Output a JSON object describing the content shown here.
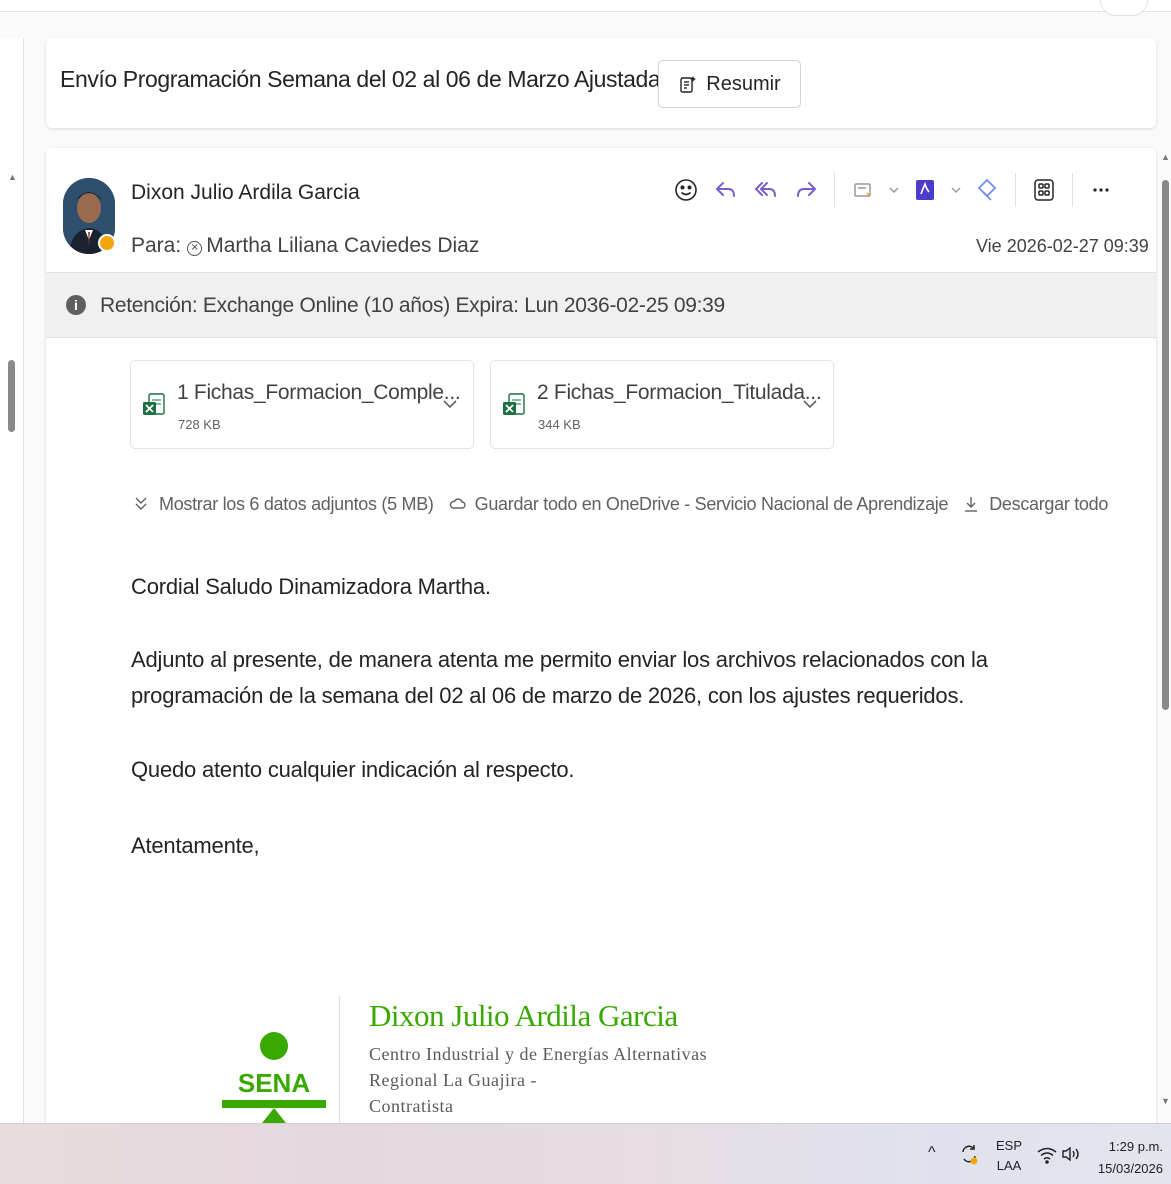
{
  "email": {
    "subject": "Envío Programación Semana del 02 al 06 de Marzo Ajustada.",
    "summarize_label": "Resumir",
    "sender": "Dixon Julio Ardila Garcia",
    "to_label": "Para:",
    "recipient": "Martha Liliana Caviedes Diaz",
    "date": "Vie 2026-02-27 09:39",
    "retention": "Retención: Exchange Online (10 años) Expira: Lun 2036-02-25 09:39",
    "actions": [
      "smiley-icon",
      "reply-icon",
      "reply-all-icon",
      "forward-icon",
      "note-icon",
      "pdf-icon",
      "loop-icon",
      "apps-icon",
      "more-icon"
    ]
  },
  "attachments": {
    "items": [
      {
        "name": "1 Fichas_Formacion_Comple...",
        "size": "728 KB",
        "icon": "excel-icon"
      },
      {
        "name": "2 Fichas_Formacion_Titulada...",
        "size": "344 KB",
        "icon": "excel-icon"
      }
    ],
    "show_all": "Mostrar los 6 datos adjuntos (5 MB)",
    "save_onedrive": "Guardar todo en OneDrive - Servicio Nacional de Aprendizaje",
    "download_all": "Descargar todo"
  },
  "body": {
    "greeting": "Cordial Saludo Dinamizadora Martha.",
    "paragraph1": "Adjunto al presente, de manera atenta me permito enviar los archivos relacionados con la programación de la semana del 02 al 06 de marzo de 2026, con los ajustes requeridos.",
    "paragraph2": "Quedo atento cualquier indicación al respecto.",
    "closing": "Atentamente,"
  },
  "signature": {
    "name": "Dixon Julio Ardila Garcia",
    "line1": "Centro Industrial y de Energías Alternativas",
    "line2": "Regional La Guajira -",
    "line3": "Contratista",
    "logo_text": "SENA",
    "brand_color": "#39a900"
  },
  "taskbar": {
    "lang_top": "ESP",
    "lang_bottom": "LAA",
    "time": "1:29 p.m.",
    "date": "15/03/2026"
  },
  "colors": {
    "accent_purple": "#7b5fc9",
    "pdf_purple": "#4b3cc9",
    "excel_green": "#1d7044"
  }
}
